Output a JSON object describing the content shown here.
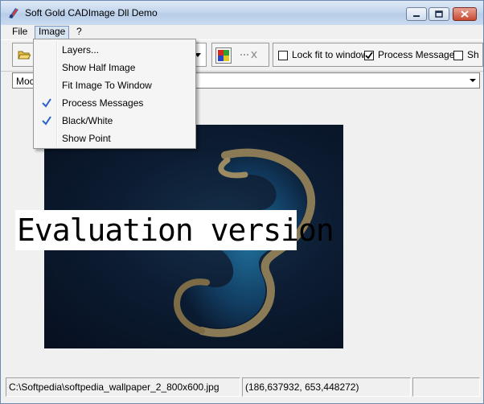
{
  "window": {
    "title": "Soft Gold CADImage Dll Demo"
  },
  "menubar": {
    "items": [
      {
        "label": "File"
      },
      {
        "label": "Image"
      },
      {
        "label": "?"
      }
    ]
  },
  "image_menu": {
    "items": [
      {
        "label": "Layers...",
        "checked": false
      },
      {
        "label": "Show Half Image",
        "checked": false
      },
      {
        "label": "Fit Image To Window",
        "checked": false
      },
      {
        "label": "Process Messages",
        "checked": true
      },
      {
        "label": "Black/White",
        "checked": true
      },
      {
        "label": "Show Point",
        "checked": false
      }
    ]
  },
  "toolbar": {
    "lock_fit_label": "Lock fit to window",
    "lock_fit_checked": false,
    "process_messages_label": "Process Messages",
    "process_messages_checked": true,
    "sh_label": "Sh",
    "sh_checked": false
  },
  "mode_combo": {
    "value": "Moc"
  },
  "canvas": {
    "watermark": "Evaluation version"
  },
  "statusbar": {
    "file_path": "C:\\Softpedia\\softpedia_wallpaper_2_800x600.jpg",
    "coordinates": "(186,637932, 653,448272)"
  },
  "colors": {
    "menu_check": "#2a62c9",
    "close_button": "#c74a32"
  }
}
